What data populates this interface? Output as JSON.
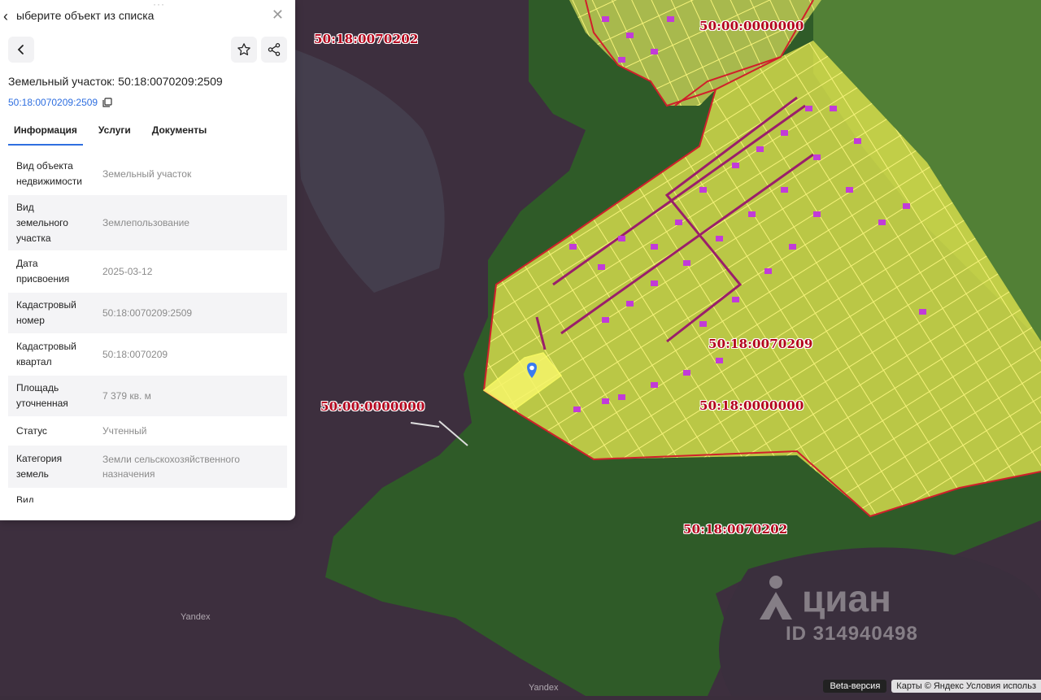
{
  "panel": {
    "drag_handle": "···",
    "title": "ыберите объект из списка",
    "heading": "Земельный участок: 50:18:0070209:2509",
    "cadastral_link": "50:18:0070209:2509",
    "tabs": [
      "Информация",
      "Услуги",
      "Документы"
    ],
    "rows": [
      {
        "key": "Вид объекта недвижимости",
        "value": "Земельный участок"
      },
      {
        "key": "Вид земельного участка",
        "value": "Землепользование"
      },
      {
        "key": "Дата присвоения",
        "value": "2025-03-12"
      },
      {
        "key": "Кадастровый номер",
        "value": "50:18:0070209:2509"
      },
      {
        "key": "Кадастровый квартал",
        "value": "50:18:0070209"
      },
      {
        "key": "Площадь уточненная",
        "value": "7 379 кв. м"
      },
      {
        "key": "Статус",
        "value": "Учтенный"
      },
      {
        "key": "Категория земель",
        "value": "Земли сельскохозяйственного назначения"
      },
      {
        "key": "Вид",
        "value": ""
      }
    ]
  },
  "map": {
    "labels": [
      "50:18:0070202",
      "50:00:0000000",
      "50:18:0070209",
      "50:00:0000000",
      "50:18:0000000",
      "50:18:0070202"
    ],
    "yandex_marks": [
      "Yandex",
      "Yandex"
    ],
    "watermark": {
      "brand": "циан",
      "id": "ID 314940498"
    },
    "beta": "Beta-версия",
    "copyright": "Карты © Яндекс  Условия использ",
    "colors": {
      "cadastral_border": "#c8202a",
      "plot_fill": "#e6ec5a",
      "building": "#c23bd8",
      "water": "#3b2e3c",
      "forest": "#2e5a26"
    }
  }
}
